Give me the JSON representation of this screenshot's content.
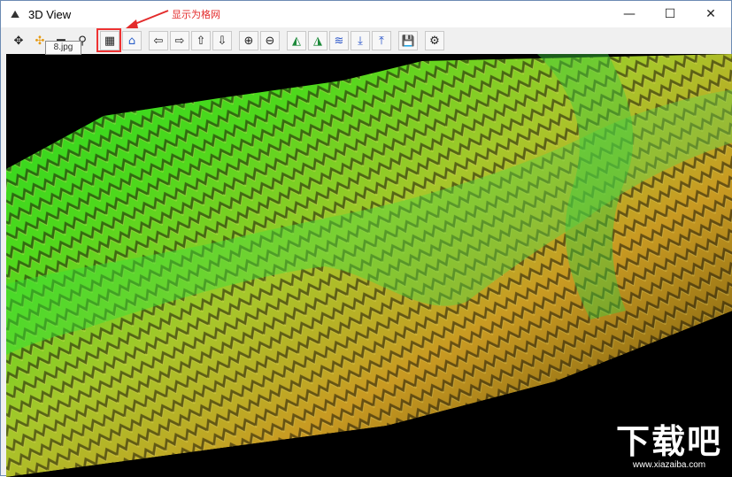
{
  "window": {
    "title": "3D View",
    "app_icon": "terrain-app-icon",
    "controls": [
      {
        "name": "minimize-button",
        "glyph": "—"
      },
      {
        "name": "maximize-button",
        "glyph": "☐"
      },
      {
        "name": "close-button",
        "glyph": "✕"
      }
    ]
  },
  "toolbar": {
    "buttons": [
      {
        "name": "pan-button",
        "icon": "move-cross-icon",
        "glyph": "✥"
      },
      {
        "name": "rotate-button",
        "icon": "orange-move-icon",
        "glyph": "✣"
      },
      {
        "name": "elevation-button",
        "icon": "layer-icon",
        "glyph": "▬"
      },
      {
        "name": "binoculars-button",
        "icon": "binoculars-icon",
        "glyph": "⚲"
      },
      {
        "name": "show-grid-button",
        "icon": "grid-box-icon",
        "glyph": "▦"
      },
      {
        "name": "home-button",
        "icon": "home-icon",
        "glyph": "⌂"
      },
      {
        "name": "move-left-button",
        "icon": "arrow-left-icon",
        "glyph": "⇦"
      },
      {
        "name": "move-right-button",
        "icon": "arrow-right-icon",
        "glyph": "⇨"
      },
      {
        "name": "move-up-button",
        "icon": "arrow-up-icon",
        "glyph": "⇧"
      },
      {
        "name": "move-down-button",
        "icon": "arrow-down-icon",
        "glyph": "⇩"
      },
      {
        "name": "zoom-in-button",
        "icon": "zoom-in-icon",
        "glyph": "⊕"
      },
      {
        "name": "zoom-out-button",
        "icon": "zoom-out-icon",
        "glyph": "⊖"
      },
      {
        "name": "terrain-view-1-button",
        "icon": "terrain-icon",
        "glyph": "◭"
      },
      {
        "name": "terrain-view-2-button",
        "icon": "terrain-icon",
        "glyph": "◮"
      },
      {
        "name": "water-view-button",
        "icon": "water-icon",
        "glyph": "≋"
      },
      {
        "name": "lower-button",
        "icon": "down-bar-icon",
        "glyph": "⤓"
      },
      {
        "name": "raise-button",
        "icon": "up-bar-icon",
        "glyph": "⤒"
      },
      {
        "name": "save-button",
        "icon": "floppy-disk-icon",
        "glyph": "💾"
      },
      {
        "name": "settings-button",
        "icon": "gear-icon",
        "glyph": "⚙"
      }
    ]
  },
  "tooltip": {
    "text": "8.jpg"
  },
  "annotation": {
    "text": "显示为格网",
    "color": "#e32b2b"
  },
  "watermark": {
    "main": "下载吧",
    "url": "www.xiazaiba.com"
  },
  "colors": {
    "terrain_low": "#1fd11f",
    "terrain_mid": "#9ccc2a",
    "terrain_high": "#d4a22a",
    "background": "#000000"
  }
}
